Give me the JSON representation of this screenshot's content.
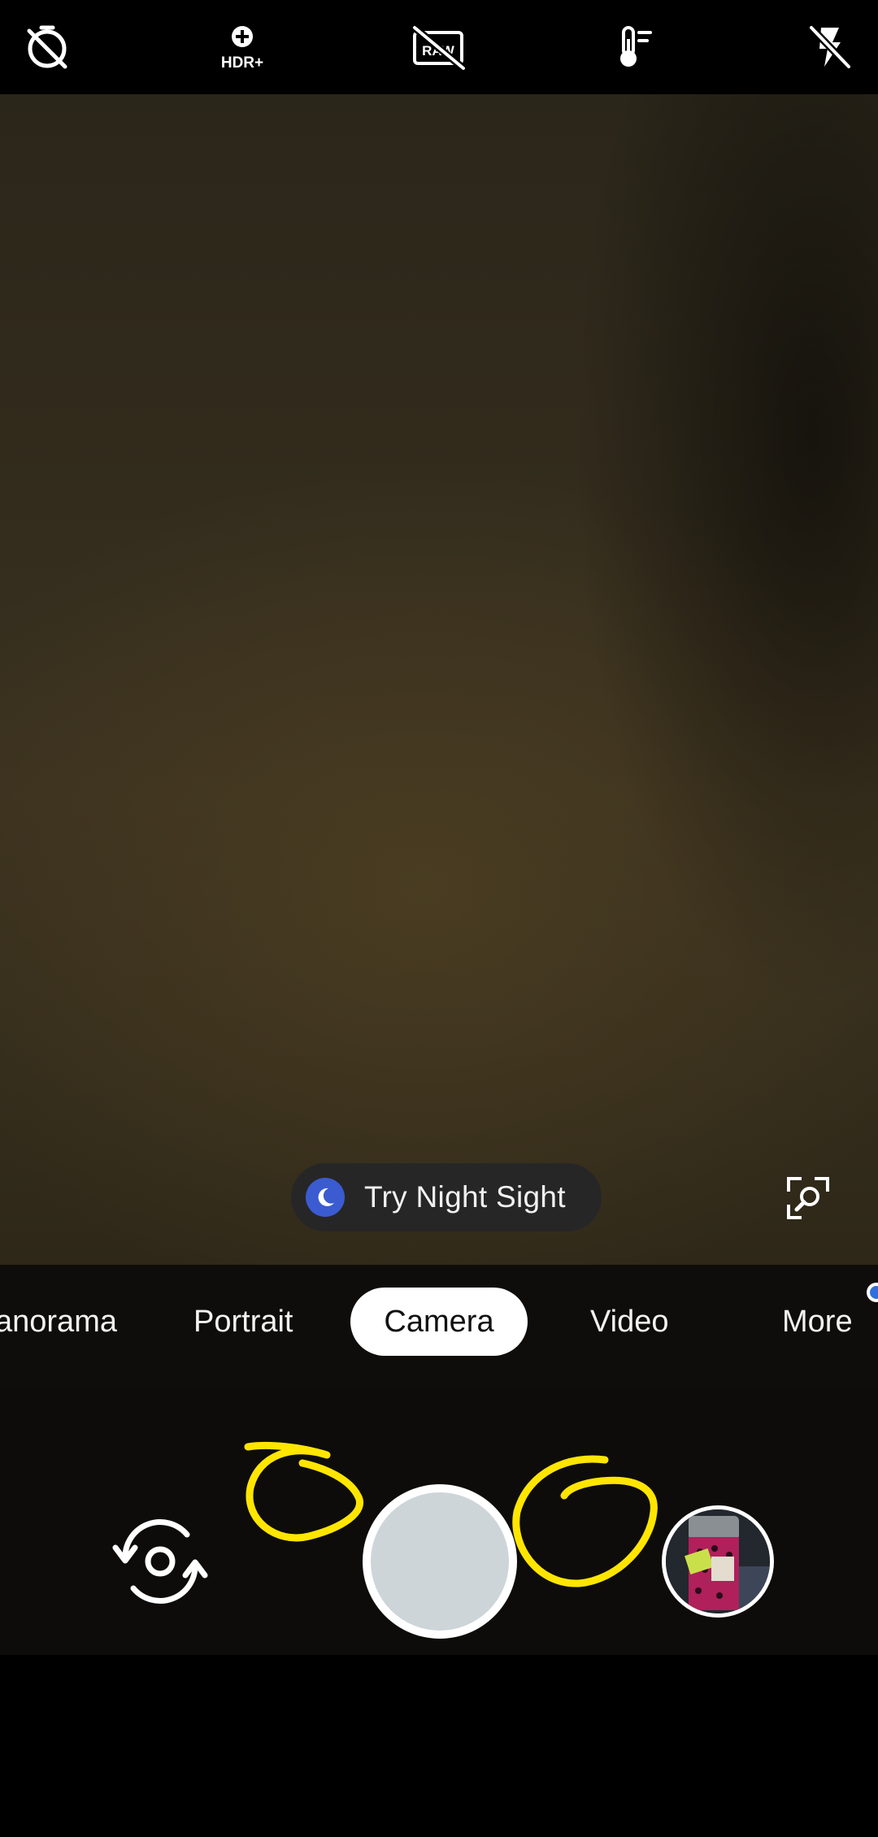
{
  "top_bar": {
    "buttons": [
      {
        "name": "timer-off-icon"
      },
      {
        "name": "hdr-plus-icon",
        "text": "HDR+"
      },
      {
        "name": "raw-off-icon",
        "text": "RAW"
      },
      {
        "name": "white-balance-icon"
      },
      {
        "name": "flash-off-icon"
      }
    ]
  },
  "viewfinder": {
    "night_sight_chip": {
      "label": "Try Night Sight",
      "icon": "moon-icon"
    },
    "lens_button": {
      "icon": "search-zoom-icon"
    }
  },
  "modes": {
    "items": [
      "anorama",
      "Portrait",
      "Camera",
      "Video",
      "More"
    ],
    "selected": "Camera"
  },
  "controls": {
    "switch_camera": {
      "icon": "switch-camera-icon"
    },
    "shutter": {
      "icon": "shutter-button"
    },
    "last_photo": {
      "icon": "gallery-thumbnail"
    }
  },
  "annotations": {
    "color": "#ffe500"
  },
  "colors": {
    "night_sight_icon_bg": "#3b5bd0",
    "more_badge": "#2f6fe0",
    "shutter_core": "#cdd5d9"
  }
}
